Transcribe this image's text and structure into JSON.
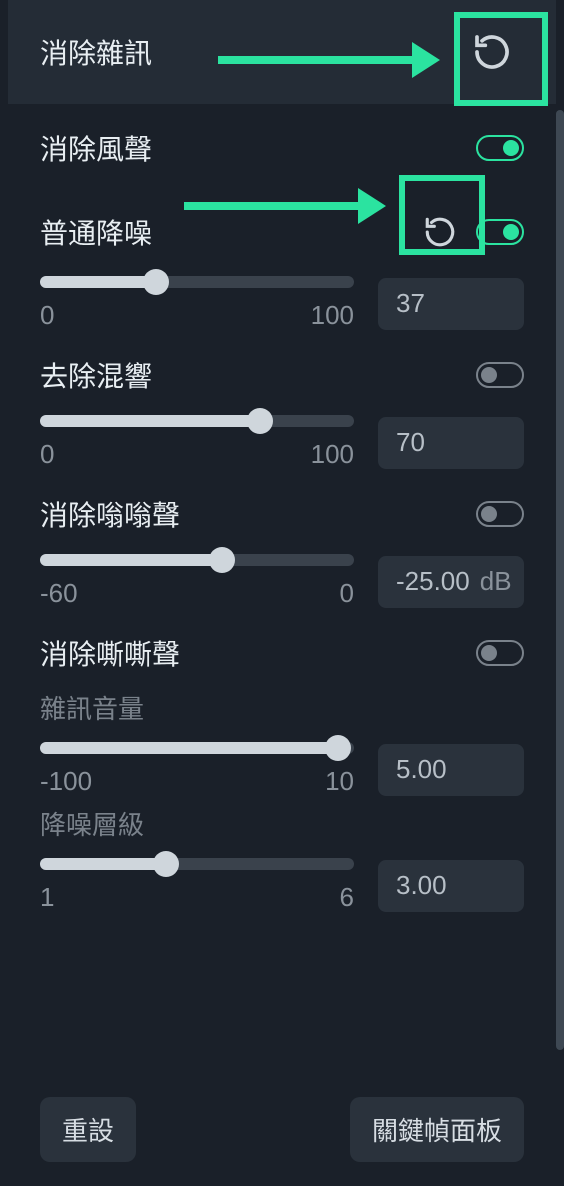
{
  "header": {
    "title": "消除雜訊"
  },
  "sections": {
    "wind": {
      "label": "消除風聲",
      "toggle_on": true
    },
    "denoise": {
      "label": "普通降噪",
      "toggle_on": true,
      "value": "37",
      "min": "0",
      "max": "100",
      "fill_pct": 37
    },
    "reverb": {
      "label": "去除混響",
      "toggle_on": false,
      "value": "70",
      "min": "0",
      "max": "100",
      "fill_pct": 70
    },
    "hum": {
      "label": "消除嗡嗡聲",
      "toggle_on": false,
      "value": "-25.00",
      "unit": "dB",
      "min": "-60",
      "max": "0",
      "fill_pct": 58
    },
    "hiss": {
      "label": "消除嘶嘶聲",
      "toggle_on": false,
      "noise_vol_label": "雜訊音量",
      "noise_vol_value": "5.00",
      "noise_vol_min": "-100",
      "noise_vol_max": "10",
      "noise_vol_fill_pct": 95,
      "level_label": "降噪層級",
      "level_value": "3.00",
      "level_min": "1",
      "level_max": "6",
      "level_fill_pct": 40
    }
  },
  "footer": {
    "reset": "重設",
    "keyframe": "關鍵幀面板"
  }
}
